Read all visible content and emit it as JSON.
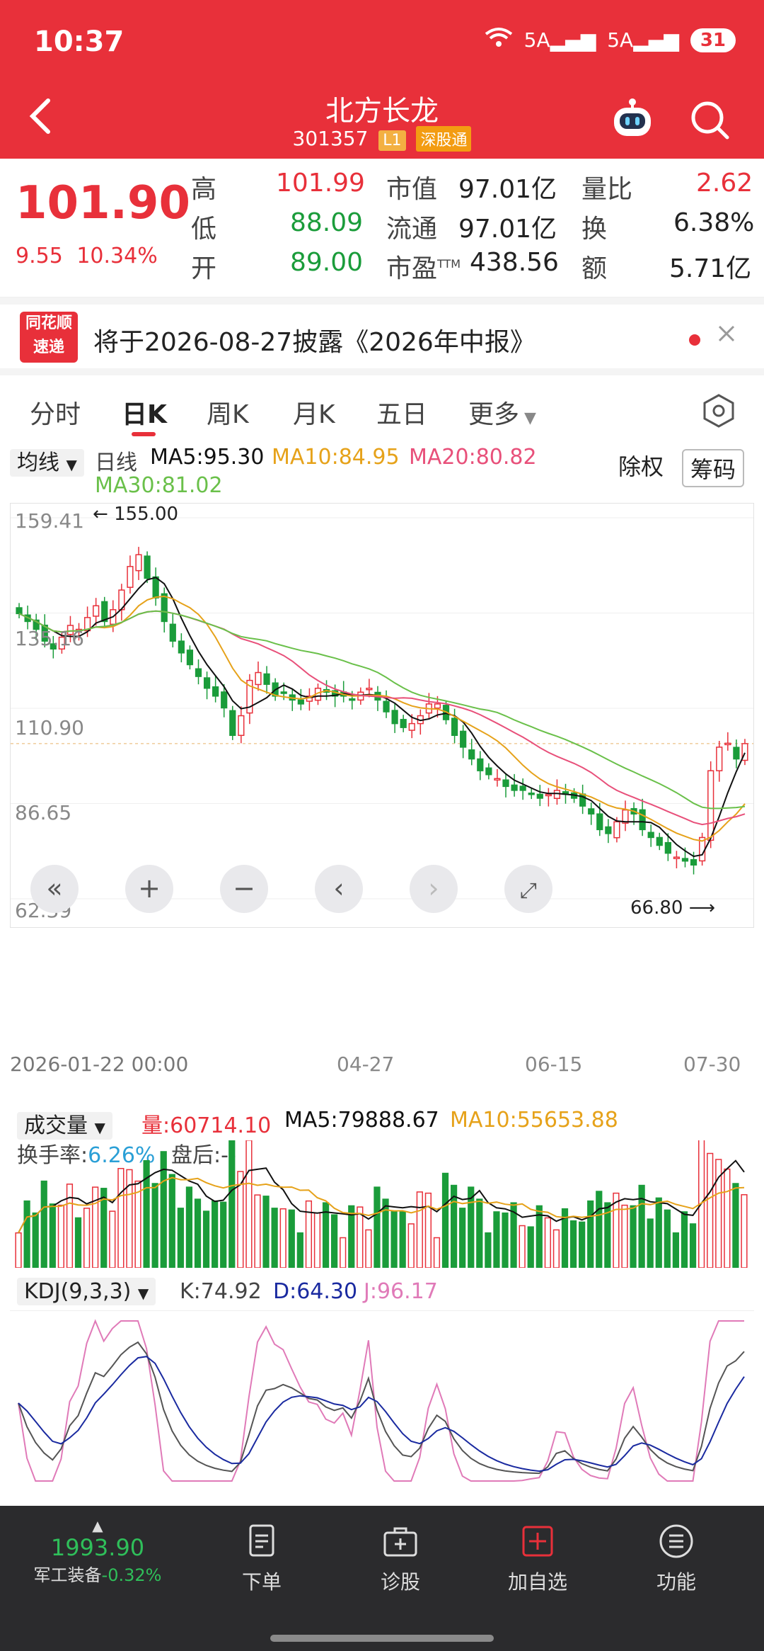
{
  "status_bar": {
    "time": "10:37",
    "signal1": "5A",
    "signal2": "5A",
    "battery": "31"
  },
  "header": {
    "stock_name": "北方长龙",
    "stock_code": "301357",
    "tag_level": "L1",
    "tag_connect": "深股通"
  },
  "quote": {
    "price": "101.90",
    "change": "9.55",
    "change_pct": "10.34%",
    "high_label": "高",
    "high": "101.99",
    "low_label": "低",
    "low": "88.09",
    "open_label": "开",
    "open": "89.00",
    "mktcap_label": "市值",
    "mktcap": "97.01亿",
    "float_label": "流通",
    "float": "97.01亿",
    "pe_label": "市盈",
    "pe_sup": "TTM",
    "pe": "438.56",
    "volratio_label": "量比",
    "volratio": "2.62",
    "turnover_label": "换",
    "turnover": "6.38%",
    "amount_label": "额",
    "amount": "5.71亿"
  },
  "notice": {
    "logo_top": "同花顺",
    "logo_bottom": "速递",
    "text": "将于2026-08-27披露《2026年中报》"
  },
  "tabs": [
    "分时",
    "日K",
    "周K",
    "月K",
    "五日",
    "更多"
  ],
  "ma": {
    "selector": "均线",
    "line_type": "日线",
    "ma5": "MA5:95.30",
    "ma10": "MA10:84.95",
    "ma20": "MA20:80.82",
    "ma30": "MA30:81.02",
    "rights_label": "除权",
    "chips_label": "筹码"
  },
  "chart_labels": {
    "y_max": "159.41",
    "y_2": "135.16",
    "y_3": "110.90",
    "y_4": "86.65",
    "y_min": "62.39",
    "high_marker": "155.00",
    "low_marker": "66.80",
    "x1": "2026-01-22 00:00",
    "x2": "04-27",
    "x3": "06-15",
    "x4": "07-30"
  },
  "volume": {
    "selector": "成交量",
    "vol": "量:60714.10",
    "ma5": "MA5:79888.67",
    "ma10": "MA10:55653.88",
    "turnover_label": "换手率:",
    "turnover_value": "6.26%",
    "after_hours": "盘后:--"
  },
  "kdj": {
    "selector": "KDJ(9,3,3)",
    "k": "K:74.92",
    "d": "D:64.30",
    "j": "J:96.17"
  },
  "bottom": {
    "index_value": "1993.90",
    "index_name": "军工装备",
    "index_change": "-0.32%",
    "order": "下单",
    "diagnose": "诊股",
    "add_watch": "加自选",
    "functions": "功能"
  },
  "colors": {
    "brand_red": "#e8303a",
    "up_red": "#e8303a",
    "down_green": "#1a9c3a",
    "ma5": "#111111",
    "ma10": "#e6a21a",
    "ma20": "#e8507a",
    "ma30": "#6ac04a"
  },
  "chart_data": {
    "type": "candlestick",
    "title": "",
    "ylim": [
      62.39,
      159.41
    ],
    "y_ticks": [
      159.41,
      135.16,
      110.9,
      86.65,
      62.39
    ],
    "x_ticks": [
      "2026-01-22 00:00",
      "04-27",
      "06-15",
      "07-30"
    ],
    "annotations": [
      {
        "label": "155.00",
        "type": "period-high"
      },
      {
        "label": "66.80",
        "type": "period-low"
      }
    ],
    "close_series": [
      135,
      133,
      131,
      128,
      126,
      129,
      132,
      131,
      134,
      137,
      133,
      136,
      141,
      147,
      150,
      144,
      139,
      133,
      128,
      125,
      122,
      119,
      116,
      114,
      111,
      104,
      109,
      118,
      120,
      117,
      114,
      115,
      113,
      112,
      114,
      116,
      115,
      114,
      114,
      113,
      115,
      116,
      113,
      110,
      107,
      106,
      107,
      109,
      112,
      112,
      108,
      104,
      101,
      98,
      95,
      94,
      93,
      91,
      90,
      90,
      89,
      88,
      89,
      90,
      89,
      88,
      86,
      84,
      80,
      79,
      82,
      85,
      84,
      80,
      78,
      76,
      74,
      73,
      72,
      71,
      78,
      95,
      101,
      102,
      98,
      101.9
    ],
    "ma5": [
      95.3
    ],
    "ma10": [
      84.95
    ],
    "ma20": [
      80.82
    ],
    "ma30": [
      81.02
    ],
    "volume_last": 60714.1,
    "volume_ma5": 79888.67,
    "volume_ma10": 55653.88,
    "kdj_last": {
      "K": 74.92,
      "D": 64.3,
      "J": 96.17
    }
  }
}
